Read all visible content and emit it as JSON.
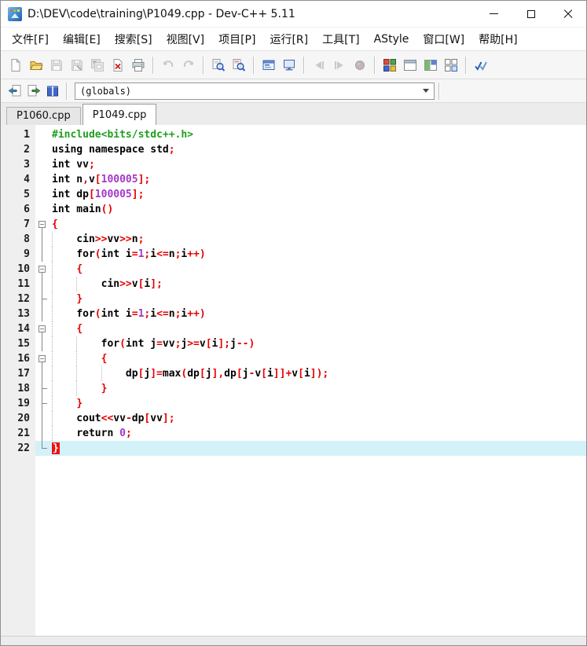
{
  "window": {
    "title": "D:\\DEV\\code\\training\\P1049.cpp - Dev-C++ 5.11",
    "controls": [
      "minimize",
      "maximize",
      "close"
    ]
  },
  "menu": {
    "items": [
      "文件[F]",
      "编辑[E]",
      "搜索[S]",
      "视图[V]",
      "项目[P]",
      "运行[R]",
      "工具[T]",
      "AStyle",
      "窗口[W]",
      "帮助[H]"
    ]
  },
  "toolbar_main": {
    "groups": [
      {
        "items": [
          {
            "name": "new-source",
            "icon": "new",
            "disabled": false
          },
          {
            "name": "open-file",
            "icon": "open",
            "disabled": false
          },
          {
            "name": "save",
            "icon": "save",
            "disabled": true
          },
          {
            "name": "save-as",
            "icon": "saveas",
            "disabled": true
          },
          {
            "name": "save-all",
            "icon": "saveall",
            "disabled": true
          },
          {
            "name": "close-file",
            "icon": "closefile",
            "disabled": false
          },
          {
            "name": "print",
            "icon": "print",
            "disabled": false
          }
        ]
      },
      {
        "items": [
          {
            "name": "undo",
            "icon": "undo",
            "disabled": true
          },
          {
            "name": "redo",
            "icon": "redo",
            "disabled": true
          }
        ]
      },
      {
        "items": [
          {
            "name": "find",
            "icon": "find",
            "disabled": false
          },
          {
            "name": "replace",
            "icon": "replace",
            "disabled": false
          }
        ]
      },
      {
        "items": [
          {
            "name": "compile",
            "icon": "compile",
            "disabled": false
          },
          {
            "name": "run",
            "icon": "run",
            "disabled": false
          }
        ]
      },
      {
        "items": [
          {
            "name": "back",
            "icon": "back",
            "disabled": true
          },
          {
            "name": "forward",
            "icon": "forward",
            "disabled": true
          },
          {
            "name": "abort-compile",
            "icon": "abort",
            "disabled": true
          }
        ]
      },
      {
        "items": [
          {
            "name": "view-grid",
            "icon": "gridc",
            "disabled": false
          },
          {
            "name": "view-window",
            "icon": "windowi",
            "disabled": false
          },
          {
            "name": "view-split",
            "icon": "splitw",
            "disabled": false
          },
          {
            "name": "view-tiles",
            "icon": "grido",
            "disabled": false
          }
        ]
      },
      {
        "items": [
          {
            "name": "syntax-check",
            "icon": "dcheck",
            "disabled": false
          }
        ]
      }
    ]
  },
  "toolbar_nav": {
    "items": [
      {
        "name": "goto-declaration",
        "icon": "pgleft",
        "disabled": false
      },
      {
        "name": "goto-definition",
        "icon": "pgright",
        "disabled": false
      },
      {
        "name": "class-browser",
        "icon": "book",
        "disabled": false
      }
    ],
    "combo": {
      "value": "(globals)"
    }
  },
  "tabs": [
    {
      "label": "P1060.cpp",
      "active": false
    },
    {
      "label": "P1049.cpp",
      "active": true
    }
  ],
  "editor": {
    "colors": {
      "preprocessor": "#1e9e1e",
      "keyword": "#000000",
      "symbol": "#e60000",
      "number": "#a337c9",
      "current_line_bg": "#d3f1f9",
      "brace_highlight_bg": "#ee1111"
    },
    "current_line": 22,
    "lines": [
      {
        "n": 1,
        "fold": "",
        "guides": [],
        "segs": [
          [
            "pre",
            "#include<bits/stdc++.h>"
          ]
        ]
      },
      {
        "n": 2,
        "fold": "",
        "guides": [],
        "segs": [
          [
            "kw",
            "using"
          ],
          [
            "pl",
            " "
          ],
          [
            "kw",
            "namespace"
          ],
          [
            "pl",
            " std"
          ],
          [
            "sym",
            ";"
          ]
        ]
      },
      {
        "n": 3,
        "fold": "",
        "guides": [],
        "segs": [
          [
            "kw",
            "int"
          ],
          [
            "pl",
            " vv"
          ],
          [
            "sym",
            ";"
          ]
        ]
      },
      {
        "n": 4,
        "fold": "",
        "guides": [],
        "segs": [
          [
            "kw",
            "int"
          ],
          [
            "pl",
            " n"
          ],
          [
            "sym",
            ","
          ],
          [
            "pl",
            "v"
          ],
          [
            "sym",
            "["
          ],
          [
            "num",
            "100005"
          ],
          [
            "sym",
            "];"
          ]
        ]
      },
      {
        "n": 5,
        "fold": "",
        "guides": [],
        "segs": [
          [
            "kw",
            "int"
          ],
          [
            "pl",
            " dp"
          ],
          [
            "sym",
            "["
          ],
          [
            "num",
            "100005"
          ],
          [
            "sym",
            "];"
          ]
        ]
      },
      {
        "n": 6,
        "fold": "",
        "guides": [],
        "segs": [
          [
            "kw",
            "int"
          ],
          [
            "pl",
            " main"
          ],
          [
            "sym",
            "()"
          ]
        ]
      },
      {
        "n": 7,
        "fold": "box",
        "guides": [],
        "segs": [
          [
            "sym",
            "{"
          ]
        ]
      },
      {
        "n": 8,
        "fold": "line",
        "guides": [
          0
        ],
        "segs": [
          [
            "pl",
            "    cin"
          ],
          [
            "sym",
            ">>"
          ],
          [
            "pl",
            "vv"
          ],
          [
            "sym",
            ">>"
          ],
          [
            "pl",
            "n"
          ],
          [
            "sym",
            ";"
          ]
        ]
      },
      {
        "n": 9,
        "fold": "line",
        "guides": [
          0
        ],
        "segs": [
          [
            "pl",
            "    "
          ],
          [
            "kw",
            "for"
          ],
          [
            "sym",
            "("
          ],
          [
            "kw",
            "int"
          ],
          [
            "pl",
            " i"
          ],
          [
            "sym",
            "="
          ],
          [
            "num",
            "1"
          ],
          [
            "sym",
            ";"
          ],
          [
            "pl",
            "i"
          ],
          [
            "sym",
            "<="
          ],
          [
            "pl",
            "n"
          ],
          [
            "sym",
            ";"
          ],
          [
            "pl",
            "i"
          ],
          [
            "sym",
            "++)"
          ]
        ]
      },
      {
        "n": 10,
        "fold": "box",
        "guides": [
          0
        ],
        "segs": [
          [
            "pl",
            "    "
          ],
          [
            "sym",
            "{"
          ]
        ]
      },
      {
        "n": 11,
        "fold": "line",
        "guides": [
          0,
          4
        ],
        "segs": [
          [
            "pl",
            "        cin"
          ],
          [
            "sym",
            ">>"
          ],
          [
            "pl",
            "v"
          ],
          [
            "sym",
            "["
          ],
          [
            "pl",
            "i"
          ],
          [
            "sym",
            "];"
          ]
        ]
      },
      {
        "n": 12,
        "fold": "endc",
        "guides": [
          0
        ],
        "segs": [
          [
            "pl",
            "    "
          ],
          [
            "sym",
            "}"
          ]
        ]
      },
      {
        "n": 13,
        "fold": "line",
        "guides": [
          0
        ],
        "segs": [
          [
            "pl",
            "    "
          ],
          [
            "kw",
            "for"
          ],
          [
            "sym",
            "("
          ],
          [
            "kw",
            "int"
          ],
          [
            "pl",
            " i"
          ],
          [
            "sym",
            "="
          ],
          [
            "num",
            "1"
          ],
          [
            "sym",
            ";"
          ],
          [
            "pl",
            "i"
          ],
          [
            "sym",
            "<="
          ],
          [
            "pl",
            "n"
          ],
          [
            "sym",
            ";"
          ],
          [
            "pl",
            "i"
          ],
          [
            "sym",
            "++)"
          ]
        ]
      },
      {
        "n": 14,
        "fold": "box",
        "guides": [
          0
        ],
        "segs": [
          [
            "pl",
            "    "
          ],
          [
            "sym",
            "{"
          ]
        ]
      },
      {
        "n": 15,
        "fold": "line",
        "guides": [
          0,
          4
        ],
        "segs": [
          [
            "pl",
            "        "
          ],
          [
            "kw",
            "for"
          ],
          [
            "sym",
            "("
          ],
          [
            "kw",
            "int"
          ],
          [
            "pl",
            " j"
          ],
          [
            "sym",
            "="
          ],
          [
            "pl",
            "vv"
          ],
          [
            "sym",
            ";"
          ],
          [
            "pl",
            "j"
          ],
          [
            "sym",
            ">="
          ],
          [
            "pl",
            "v"
          ],
          [
            "sym",
            "["
          ],
          [
            "pl",
            "i"
          ],
          [
            "sym",
            "];"
          ],
          [
            "pl",
            "j"
          ],
          [
            "sym",
            "--)"
          ]
        ]
      },
      {
        "n": 16,
        "fold": "box",
        "guides": [
          0,
          4
        ],
        "segs": [
          [
            "pl",
            "        "
          ],
          [
            "sym",
            "{"
          ]
        ]
      },
      {
        "n": 17,
        "fold": "line",
        "guides": [
          0,
          4,
          8
        ],
        "segs": [
          [
            "pl",
            "            dp"
          ],
          [
            "sym",
            "["
          ],
          [
            "pl",
            "j"
          ],
          [
            "sym",
            "]="
          ],
          [
            "pl",
            "max"
          ],
          [
            "sym",
            "("
          ],
          [
            "pl",
            "dp"
          ],
          [
            "sym",
            "["
          ],
          [
            "pl",
            "j"
          ],
          [
            "sym",
            "],"
          ],
          [
            "pl",
            "dp"
          ],
          [
            "sym",
            "["
          ],
          [
            "pl",
            "j"
          ],
          [
            "sym",
            "-"
          ],
          [
            "pl",
            "v"
          ],
          [
            "sym",
            "["
          ],
          [
            "pl",
            "i"
          ],
          [
            "sym",
            "]]+"
          ],
          [
            "pl",
            "v"
          ],
          [
            "sym",
            "["
          ],
          [
            "pl",
            "i"
          ],
          [
            "sym",
            "]);"
          ]
        ]
      },
      {
        "n": 18,
        "fold": "endc",
        "guides": [
          0,
          4
        ],
        "segs": [
          [
            "pl",
            "        "
          ],
          [
            "sym",
            "}"
          ]
        ]
      },
      {
        "n": 19,
        "fold": "endc",
        "guides": [
          0
        ],
        "segs": [
          [
            "pl",
            "    "
          ],
          [
            "sym",
            "}"
          ]
        ]
      },
      {
        "n": 20,
        "fold": "line",
        "guides": [
          0
        ],
        "segs": [
          [
            "pl",
            "    cout"
          ],
          [
            "sym",
            "<<"
          ],
          [
            "pl",
            "vv"
          ],
          [
            "sym",
            "-"
          ],
          [
            "pl",
            "dp"
          ],
          [
            "sym",
            "["
          ],
          [
            "pl",
            "vv"
          ],
          [
            "sym",
            "];"
          ]
        ]
      },
      {
        "n": 21,
        "fold": "line",
        "guides": [
          0
        ],
        "segs": [
          [
            "pl",
            "    "
          ],
          [
            "kw",
            "return"
          ],
          [
            "pl",
            " "
          ],
          [
            "num",
            "0"
          ],
          [
            "sym",
            ";"
          ]
        ]
      },
      {
        "n": 22,
        "fold": "end",
        "guides": [],
        "current": true,
        "segs": [
          [
            "bhl",
            "}"
          ]
        ]
      }
    ]
  }
}
